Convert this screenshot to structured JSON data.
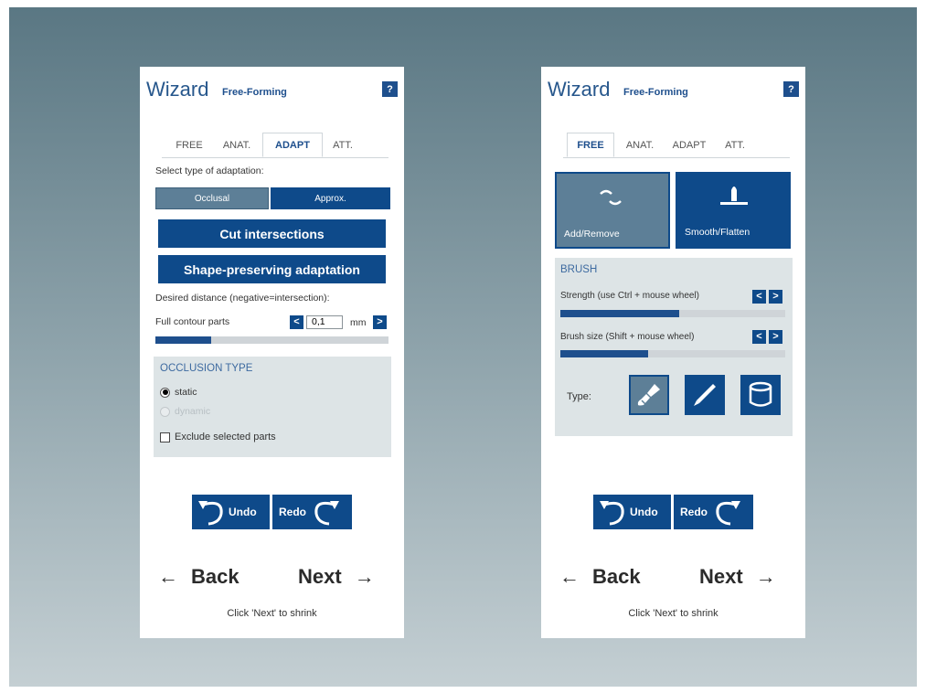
{
  "left": {
    "title": "Wizard",
    "subtitle": "Free-Forming",
    "help": "?",
    "tabs": [
      "FREE",
      "ANAT.",
      "ADAPT",
      "ATT."
    ],
    "active_tab": "ADAPT",
    "adapt_type_label": "Select type of adaptation:",
    "adapt_options": [
      "Occlusal",
      "Approx."
    ],
    "selected_adapt_option": "Occlusal",
    "cut_button": "Cut intersections",
    "shape_button": "Shape-preserving adaptation",
    "distance_label": "Desired distance (negative=intersection):",
    "parts_label": "Full contour parts",
    "distance_value": "0,1",
    "distance_unit": "mm",
    "distance_slider_fraction": 0.24,
    "occlusion": {
      "title": "OCCLUSION TYPE",
      "options": [
        "static",
        "dynamic"
      ],
      "selected": "static",
      "exclude_label": "Exclude selected parts",
      "exclude_checked": false
    },
    "undo": "Undo",
    "redo": "Redo",
    "back": "Back",
    "next": "Next",
    "hint": "Click 'Next' to shrink"
  },
  "right": {
    "title": "Wizard",
    "subtitle": "Free-Forming",
    "help": "?",
    "tabs": [
      "FREE",
      "ANAT.",
      "ADAPT",
      "ATT."
    ],
    "active_tab": "FREE",
    "modes": [
      "Add/Remove",
      "Smooth/Flatten"
    ],
    "selected_mode": "Add/Remove",
    "brush": {
      "title": "BRUSH",
      "strength_label": "Strength (use Ctrl + mouse wheel)",
      "strength_fraction": 0.53,
      "size_label": "Brush size (Shift + mouse wheel)",
      "size_fraction": 0.39,
      "type_label": "Type:",
      "types": [
        "brush-icon",
        "pen-icon",
        "cylinder-icon"
      ],
      "selected_type": "brush-icon"
    },
    "undo": "Undo",
    "redo": "Redo",
    "back": "Back",
    "next": "Next",
    "hint": "Click 'Next' to shrink"
  },
  "colors": {
    "accent": "#0e4a8a",
    "selected": "#5d7f97",
    "section_bg": "#dde4e6"
  }
}
